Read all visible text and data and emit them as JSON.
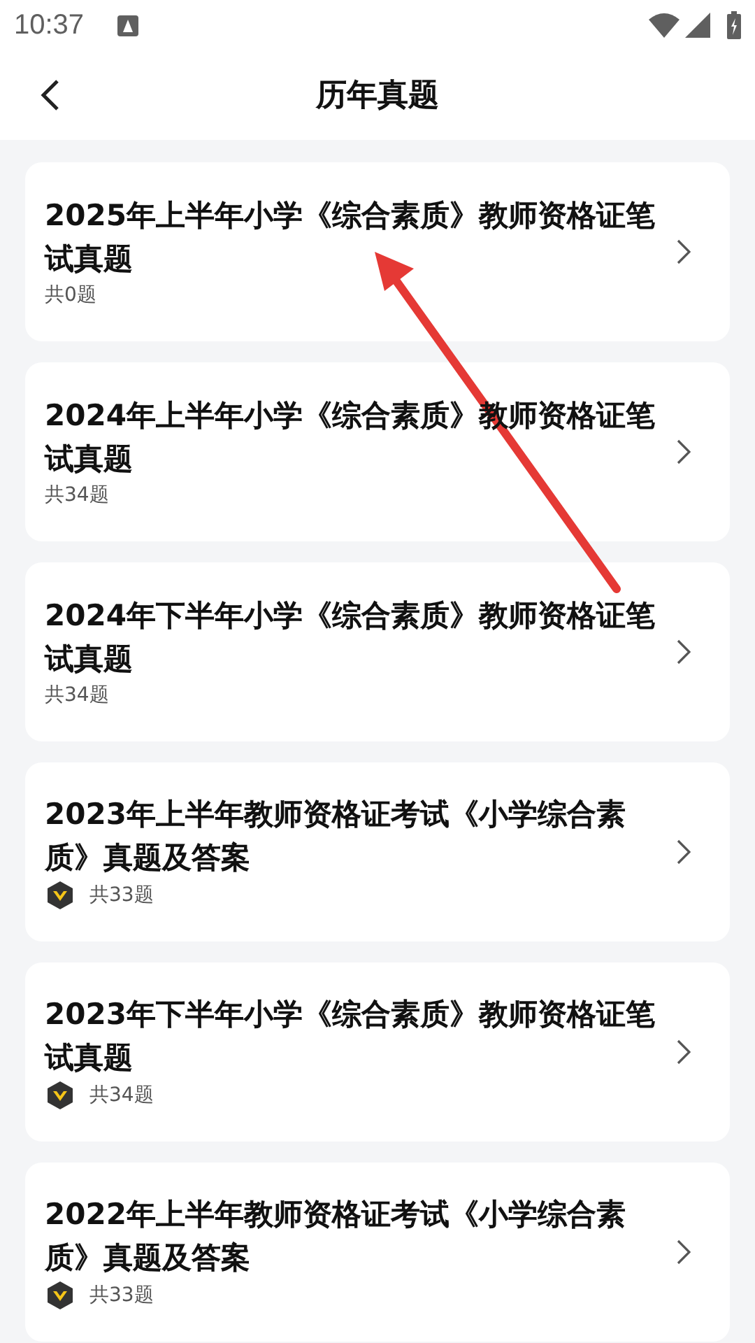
{
  "status_bar": {
    "time": "10:37"
  },
  "header": {
    "title": "历年真题"
  },
  "items": [
    {
      "title": "2025年上半年小学《综合素质》教师资格证笔试真题",
      "count": "共0题",
      "vip": false
    },
    {
      "title": "2024年上半年小学《综合素质》教师资格证笔试真题",
      "count": "共34题",
      "vip": false
    },
    {
      "title": "2024年下半年小学《综合素质》教师资格证笔试真题",
      "count": "共34题",
      "vip": false
    },
    {
      "title": "2023年上半年教师资格证考试《小学综合素质》真题及答案",
      "count": "共33题",
      "vip": true
    },
    {
      "title": "2023年下半年小学《综合素质》教师资格证笔试真题",
      "count": "共34题",
      "vip": true
    },
    {
      "title": "2022年上半年教师资格证考试《小学综合素质》真题及答案",
      "count": "共33题",
      "vip": true
    }
  ]
}
